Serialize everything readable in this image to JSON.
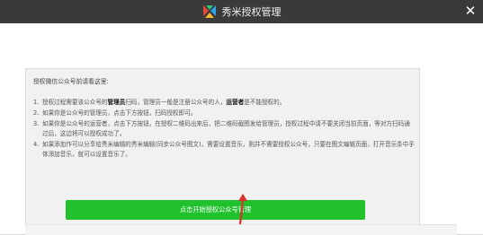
{
  "window": {
    "title": "秀米授权管理",
    "close_label": "✕"
  },
  "notice": {
    "title": "授权微信公众号前请看这里:",
    "items": [
      {
        "num": "1.",
        "p1": "授权过程需要该公众号的",
        "b1": "管理员",
        "p2": "扫码，管理员一般是注册公众号的人，",
        "b2": "运营者",
        "p3": "是不能授权的。"
      },
      {
        "num": "2.",
        "text": "如果你是公众号的管理员，点击下方按钮，扫码授权即可。"
      },
      {
        "num": "3.",
        "text": "如果你是公众号的运营者，点击下方按钮，在授权二维码出来后，把二维码截图发给管理员，授权过程中请不要关闭当前页面，等对方扫码通过后，这边将可以授权成功了。"
      },
      {
        "num": "4.",
        "text": "如果添加作可以分享给秀米编辑的秀米编辑(同步公众号图文)，需要设置音乐，则并不需要授权公众号，只要在图文编辑页面，打开音乐条中手体添加音乐，就可以设置音乐了。"
      }
    ]
  },
  "auth_button": {
    "label": "点击开始授权公众号管理"
  },
  "colors": {
    "titlebar": "#3a3a3a",
    "button": "#21c12d",
    "arrow": "#d9302c"
  }
}
